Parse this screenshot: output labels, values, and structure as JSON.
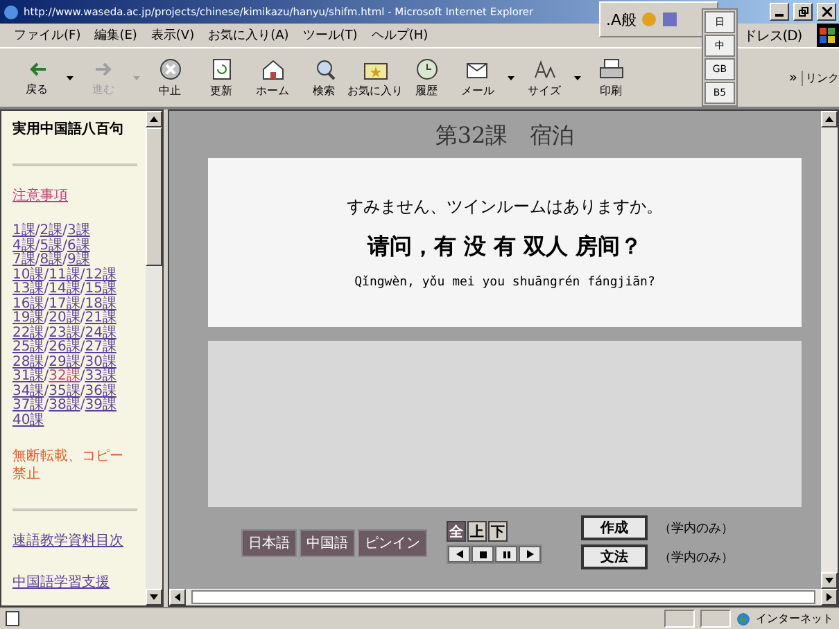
{
  "window": {
    "title": "http://www.waseda.ac.jp/projects/chinese/kimikazu/hanyu/shifm.html - Microsoft Internet Explorer"
  },
  "ime_bar": {
    "label": ".A般"
  },
  "ime_menu": [
    {
      "label": "日",
      "selected": false
    },
    {
      "label": "中",
      "selected": false
    },
    {
      "label": "GB",
      "selected": false
    },
    {
      "label": "B5",
      "selected": false
    }
  ],
  "menu": [
    "ファイル(F)",
    "編集(E)",
    "表示(V)",
    "お気に入り(A)",
    "ツール(T)",
    "ヘルプ(H)"
  ],
  "address_label": "ドレス(D)",
  "toolbar": [
    {
      "kind": "back",
      "label": "戻る",
      "disabled": false,
      "dropdown": true
    },
    {
      "kind": "forward",
      "label": "進む",
      "disabled": true,
      "dropdown": true
    },
    {
      "kind": "stop",
      "label": "中止",
      "disabled": false,
      "dropdown": false
    },
    {
      "kind": "refresh",
      "label": "更新",
      "disabled": false,
      "dropdown": false
    },
    {
      "kind": "home",
      "label": "ホーム",
      "disabled": false,
      "dropdown": false
    },
    {
      "kind": "search",
      "label": "検索",
      "disabled": false,
      "dropdown": false
    },
    {
      "kind": "favorites",
      "label": "お気に入り",
      "disabled": false,
      "dropdown": false
    },
    {
      "kind": "history",
      "label": "履歴",
      "disabled": false,
      "dropdown": false
    },
    {
      "kind": "mail",
      "label": "メール",
      "disabled": false,
      "dropdown": true
    },
    {
      "kind": "size",
      "label": "サイズ",
      "disabled": false,
      "dropdown": true
    },
    {
      "kind": "print",
      "label": "印刷",
      "disabled": false,
      "dropdown": false
    }
  ],
  "toolbar_more": "»",
  "links_label": "リンク",
  "sidebar": {
    "title": "実用中国語八百句",
    "notice_link": "注意事項",
    "lesson_separator": "/",
    "lesson_rows": [
      [
        {
          "label": "1課",
          "selected": false
        },
        {
          "label": "2課",
          "selected": false
        },
        {
          "label": "3課",
          "selected": false
        }
      ],
      [
        {
          "label": "4課",
          "selected": false
        },
        {
          "label": "5課",
          "selected": false
        },
        {
          "label": "6課",
          "selected": false
        }
      ],
      [
        {
          "label": "7課",
          "selected": false
        },
        {
          "label": "8課",
          "selected": false
        },
        {
          "label": "9課",
          "selected": false
        }
      ],
      [
        {
          "label": "10課",
          "selected": false
        },
        {
          "label": "11課",
          "selected": false
        },
        {
          "label": "12課",
          "selected": false
        }
      ],
      [
        {
          "label": "13課",
          "selected": false
        },
        {
          "label": "14課",
          "selected": false
        },
        {
          "label": "15課",
          "selected": false
        }
      ],
      [
        {
          "label": "16課",
          "selected": false
        },
        {
          "label": "17課",
          "selected": false
        },
        {
          "label": "18課",
          "selected": false
        }
      ],
      [
        {
          "label": "19課",
          "selected": false
        },
        {
          "label": "20課",
          "selected": false
        },
        {
          "label": "21課",
          "selected": false
        }
      ],
      [
        {
          "label": "22課",
          "selected": false
        },
        {
          "label": "23課",
          "selected": false
        },
        {
          "label": "24課",
          "selected": false
        }
      ],
      [
        {
          "label": "25課",
          "selected": false
        },
        {
          "label": "26課",
          "selected": false
        },
        {
          "label": "27課",
          "selected": false
        }
      ],
      [
        {
          "label": "28課",
          "selected": false
        },
        {
          "label": "29課",
          "selected": false
        },
        {
          "label": "30課",
          "selected": false
        }
      ],
      [
        {
          "label": "31課",
          "selected": false
        },
        {
          "label": "32課",
          "selected": true
        },
        {
          "label": "33課",
          "selected": false
        }
      ],
      [
        {
          "label": "34課",
          "selected": false
        },
        {
          "label": "35課",
          "selected": false
        },
        {
          "label": "36課",
          "selected": false
        }
      ],
      [
        {
          "label": "37課",
          "selected": false
        },
        {
          "label": "38課",
          "selected": false
        },
        {
          "label": "39課",
          "selected": false
        }
      ],
      [
        {
          "label": "40課",
          "selected": false
        }
      ]
    ],
    "copyright": "無断転載、コピー禁止",
    "links": [
      "速語教学資料目次",
      "中国語学習支援"
    ]
  },
  "lesson": {
    "title": "第32課　宿泊",
    "japanese": "すみません、ツインルームはありますか。",
    "chinese": "请问，有 没 有 双人 房间？",
    "pinyin": "Qǐngwèn, yǒu mei you shuāngrén fángjiān?"
  },
  "language_buttons": [
    "日本語",
    "中国語",
    "ピンイン"
  ],
  "part_buttons": [
    {
      "label": "全",
      "selected": true
    },
    {
      "label": "上",
      "selected": false
    },
    {
      "label": "下",
      "selected": false
    }
  ],
  "playback": [
    {
      "kind": "prev"
    },
    {
      "kind": "stop"
    },
    {
      "kind": "pause"
    },
    {
      "kind": "next"
    }
  ],
  "extra_buttons": [
    {
      "label": "作成",
      "note": "（学内のみ）"
    },
    {
      "label": "文法",
      "note": "（学内のみ）"
    }
  ],
  "status_bar": {
    "zone": "インターネット"
  }
}
